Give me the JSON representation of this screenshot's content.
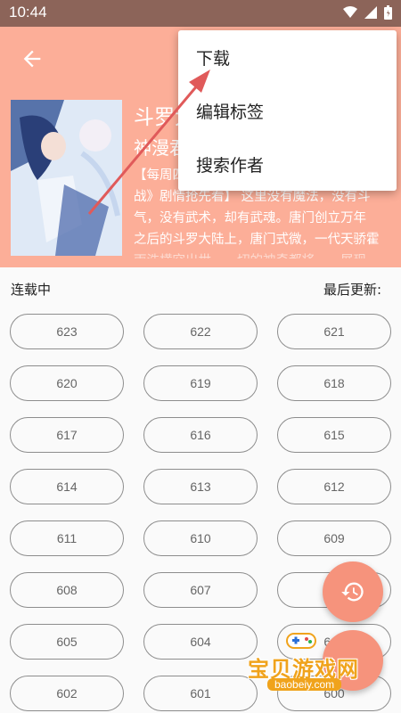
{
  "status_bar": {
    "time": "10:44"
  },
  "book": {
    "title": "斗罗大陆",
    "author": "神漫君",
    "description_lines": [
      "【每周四",
      "战》剧情抢先看】 这里没有魔法，没有斗",
      "气，没有武术，却有武魂。唐门创立万年",
      "之后的斗罗大陆上，唐门式微，一代天骄霍",
      "雨浩横空出世，一切的神奇都将一一展现"
    ]
  },
  "status": {
    "serial": "连载中",
    "last_update": "最后更新:"
  },
  "chapters": [
    "623",
    "622",
    "621",
    "620",
    "619",
    "618",
    "617",
    "616",
    "615",
    "614",
    "613",
    "612",
    "611",
    "610",
    "609",
    "608",
    "607",
    "606",
    "605",
    "604",
    "603",
    "602",
    "601",
    "600"
  ],
  "menu": {
    "items": [
      "下载",
      "编辑标签",
      "搜索作者"
    ]
  },
  "fab": {
    "history_icon": "history-icon"
  },
  "watermark": {
    "text": "宝贝游戏网",
    "url": "baobeiy.com"
  },
  "colors": {
    "header_bg": "#fcae98",
    "status_bg": "#8c6459",
    "accent": "#f6937c",
    "arrow": "#e05a5a"
  }
}
